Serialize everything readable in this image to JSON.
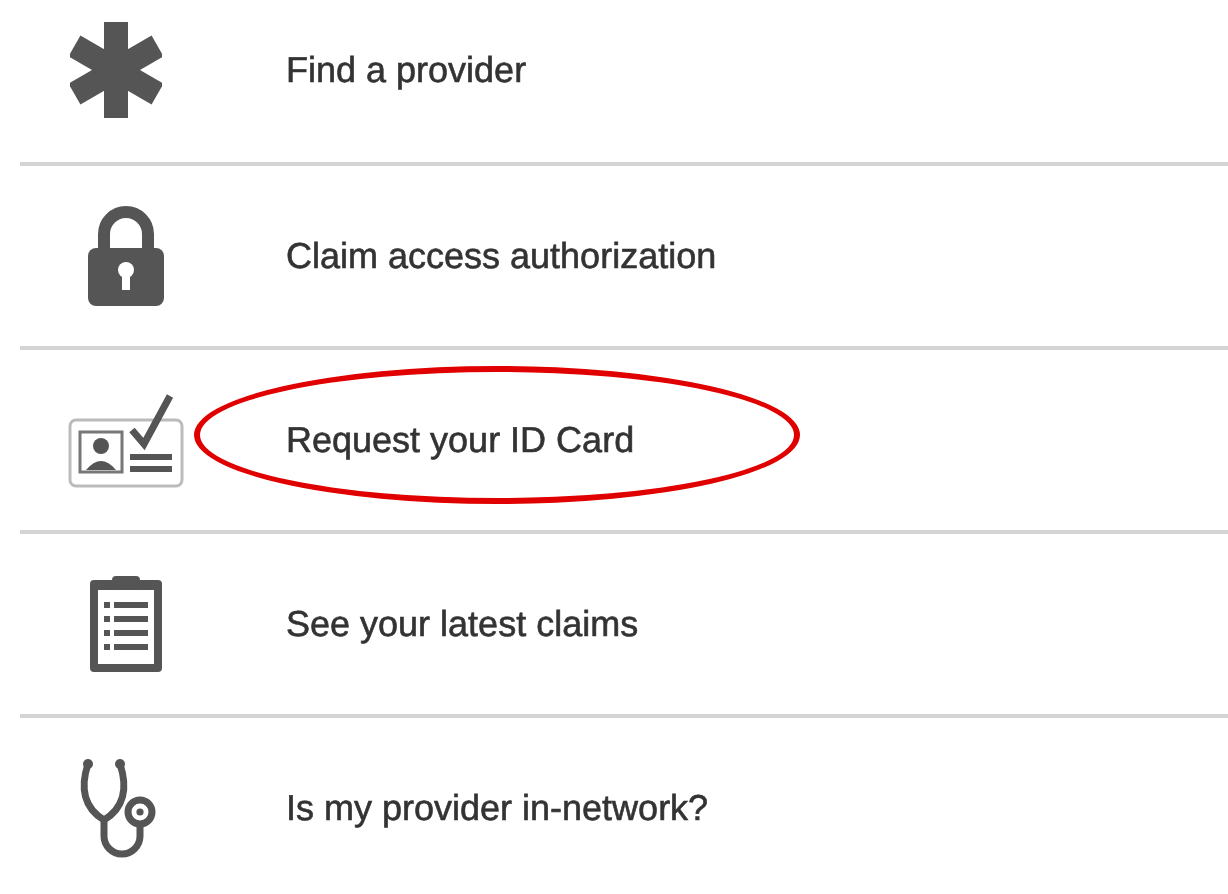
{
  "menu_items": [
    {
      "label": "Find a provider",
      "highlighted": false
    },
    {
      "label": "Claim access authorization",
      "highlighted": false
    },
    {
      "label": "Request your ID Card",
      "highlighted": true
    },
    {
      "label": "See your latest claims",
      "highlighted": false
    },
    {
      "label": "Is my provider in-network?",
      "highlighted": false
    }
  ]
}
